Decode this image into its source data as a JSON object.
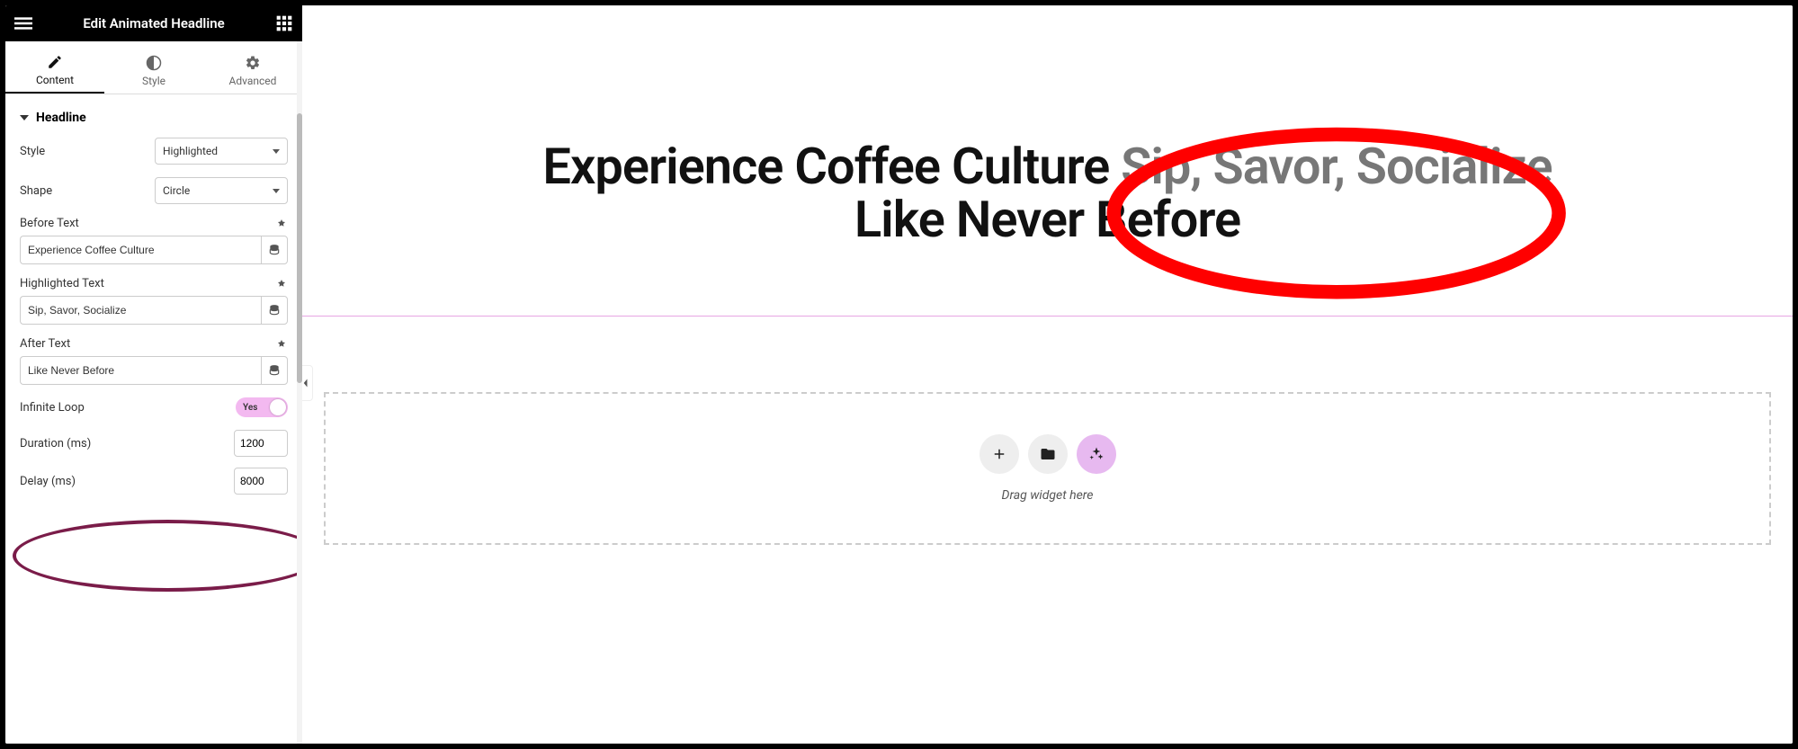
{
  "header": {
    "title": "Edit Animated Headline"
  },
  "tabs": {
    "content": "Content",
    "style": "Style",
    "advanced": "Advanced",
    "active": "content"
  },
  "section": {
    "headline_label": "Headline"
  },
  "controls": {
    "style": {
      "label": "Style",
      "value": "Highlighted"
    },
    "shape": {
      "label": "Shape",
      "value": "Circle"
    },
    "before_text": {
      "label": "Before Text",
      "value": "Experience Coffee Culture"
    },
    "highlighted_text": {
      "label": "Highlighted Text",
      "value": "Sip, Savor, Socialize"
    },
    "after_text": {
      "label": "After Text",
      "value": "Like Never Before"
    },
    "infinite_loop": {
      "label": "Infinite Loop",
      "value_label": "Yes"
    },
    "duration": {
      "label": "Duration (ms)",
      "value": "1200"
    },
    "delay": {
      "label": "Delay (ms)",
      "value": "8000"
    }
  },
  "canvas": {
    "headline": {
      "before": "Experience Coffee Culture",
      "highlighted": "Sip, Savor, Socialize",
      "after": "Like Never Before"
    },
    "drop_zone": {
      "label": "Drag widget here"
    }
  }
}
